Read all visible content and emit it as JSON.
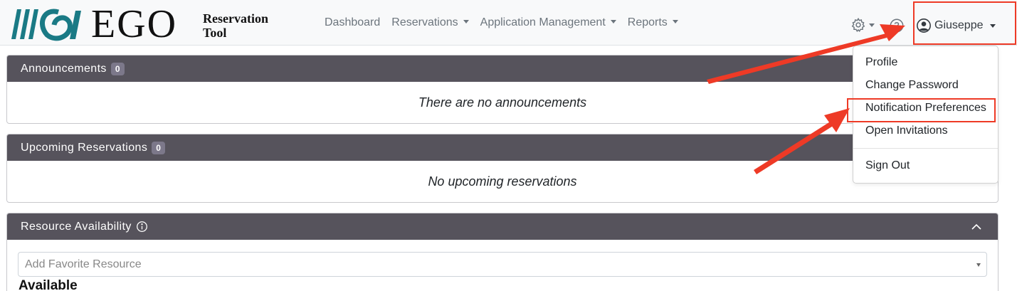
{
  "brand": {
    "name": "EGO",
    "subtitle_line1": "Reservation",
    "subtitle_line2": "Tool"
  },
  "nav": {
    "items": [
      {
        "label": "Dashboard",
        "dropdown": false
      },
      {
        "label": "Reservations",
        "dropdown": true
      },
      {
        "label": "Application Management",
        "dropdown": true
      },
      {
        "label": "Reports",
        "dropdown": true
      }
    ],
    "icons": [
      "gear-icon",
      "help-icon",
      "user-circle-icon"
    ],
    "user_name": "Giuseppe"
  },
  "user_menu": {
    "items": [
      {
        "label": "Profile"
      },
      {
        "label": "Change Password"
      },
      {
        "label": "Notification Preferences",
        "highlighted": true
      },
      {
        "label": "Open Invitations"
      }
    ],
    "sign_out": "Sign Out"
  },
  "announcements": {
    "title": "Announcements",
    "count": "0",
    "empty_text": "There are no announcements"
  },
  "upcoming": {
    "title": "Upcoming Reservations",
    "count": "0",
    "empty_text": "No upcoming reservations"
  },
  "resource_availability": {
    "title": "Resource Availability",
    "favorite_placeholder": "Add Favorite Resource",
    "available_heading": "Available"
  },
  "colors": {
    "card_header": "#56535c",
    "annotation": "#ee3a26",
    "navbar": "#f8f9fa"
  }
}
